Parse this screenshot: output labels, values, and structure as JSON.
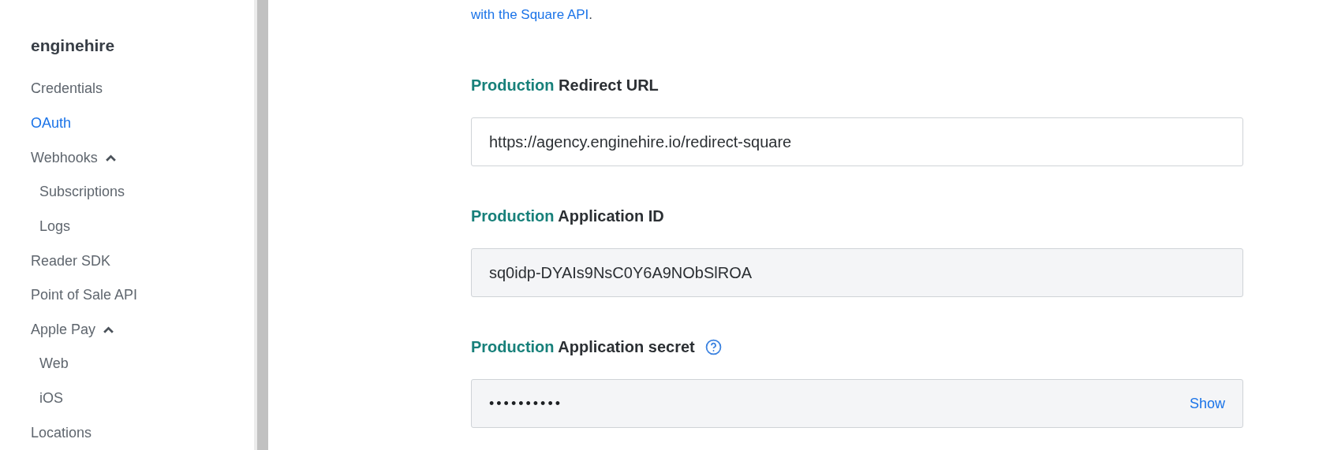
{
  "sidebar": {
    "title": "enginehire",
    "items": [
      {
        "label": "Credentials",
        "selected": false
      },
      {
        "label": "OAuth",
        "selected": true
      },
      {
        "label": "Webhooks",
        "selected": false,
        "expanded": true,
        "children": [
          {
            "label": "Subscriptions",
            "selected": false
          },
          {
            "label": "Logs",
            "selected": false
          }
        ]
      },
      {
        "label": "Reader SDK",
        "selected": false
      },
      {
        "label": "Point of Sale API",
        "selected": false
      },
      {
        "label": "Apple Pay",
        "selected": false,
        "expanded": true,
        "children": [
          {
            "label": "Web",
            "selected": false
          },
          {
            "label": "iOS",
            "selected": false
          }
        ]
      },
      {
        "label": "Locations",
        "selected": false
      }
    ]
  },
  "intro": {
    "link": "with the Square API",
    "tail": "."
  },
  "fields": [
    {
      "kind": "text",
      "env": "Production",
      "label": "Redirect URL",
      "value": "https://agency.enginehire.io/redirect-square"
    },
    {
      "kind": "readonly",
      "env": "Production",
      "label": "Application ID",
      "value": "sq0idp-DYAIs9NsC0Y6A9NObSlROA"
    },
    {
      "kind": "secret",
      "env": "Production",
      "label": "Application secret",
      "help": true,
      "value": "••••••••••",
      "action": "Show"
    }
  ]
}
